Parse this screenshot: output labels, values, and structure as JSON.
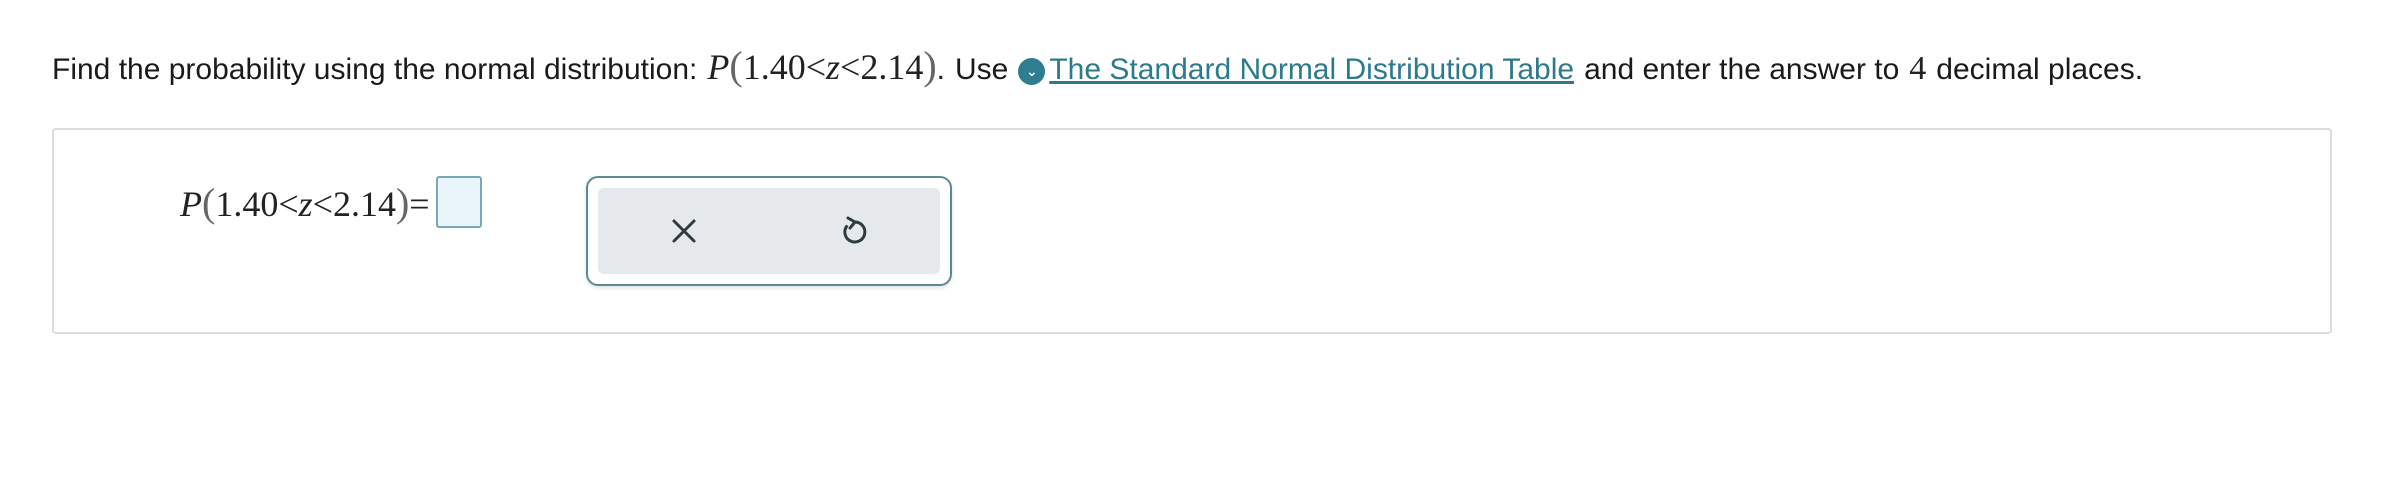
{
  "question": {
    "prefix": "Find the probability using the normal distribution:",
    "math_p": "P",
    "math_open": "(",
    "math_body_1": "1.40<",
    "math_z": "z",
    "math_body_2": "<2.14",
    "math_close": ")",
    "period": ".",
    "use_text": "Use",
    "link_text": "The Standard Normal Distribution Table",
    "suffix_1": "and enter the answer to",
    "decimals": "4",
    "suffix_2": "decimal places."
  },
  "answer": {
    "math_p": "P",
    "math_open": "(",
    "math_body_1": "1.40<",
    "math_z": "z",
    "math_body_2": "<2.14",
    "math_close": ")",
    "equals": "=",
    "input_value": ""
  },
  "toolbar": {
    "clear_icon": "close-icon",
    "reset_icon": "undo-icon"
  },
  "colors": {
    "accent": "#2c7a8c",
    "info_icon_bg": "#2f7d92",
    "toolbar_border": "#5a8a96",
    "toolbar_bg": "#e6e9eb",
    "input_bg": "#eaf5fb"
  }
}
